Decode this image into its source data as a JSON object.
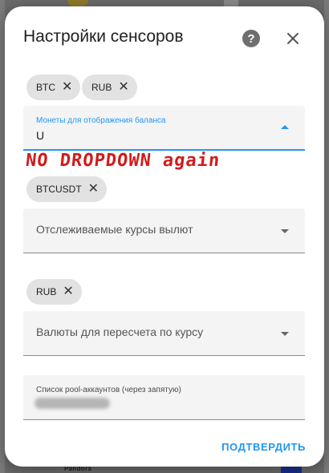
{
  "background": {
    "brand_text": "Pandora"
  },
  "dialog": {
    "title": "Настройки сенсоров",
    "help_icon": "help-circle-icon",
    "close_icon": "close-icon",
    "balance_chips": [
      "BTC",
      "RUB"
    ],
    "balance_field": {
      "label": "Монеты для отображения баланса",
      "value": "U"
    },
    "annotation": "NO DROPDOWN again",
    "rates_chips": [
      "BTCUSDT"
    ],
    "rates_field": {
      "placeholder": "Отслеживаемые курсы вылют"
    },
    "currency_chips": [
      "RUB"
    ],
    "currency_field": {
      "placeholder": "Валюты для пересчета по курсу"
    },
    "pool_field": {
      "label": "Список pool-аккаунтов (через запятую)"
    },
    "confirm_label": "ПОДТВЕРДИТЬ",
    "colors": {
      "accent": "#2196f3",
      "annotation": "#d21b1b"
    }
  }
}
